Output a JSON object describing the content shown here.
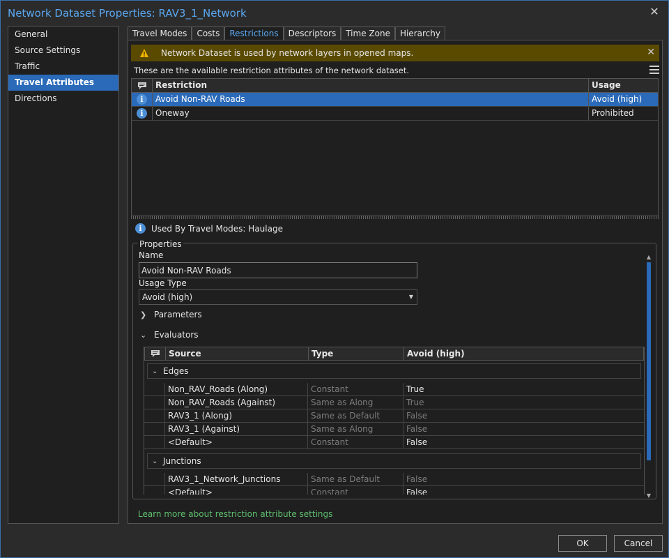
{
  "window": {
    "title": "Network Dataset Properties: RAV3_1_Network",
    "close_icon": "close-icon"
  },
  "nav": {
    "items": [
      {
        "label": "General",
        "active": false
      },
      {
        "label": "Source Settings",
        "active": false
      },
      {
        "label": "Traffic",
        "active": false
      },
      {
        "label": "Travel Attributes",
        "active": true
      },
      {
        "label": "Directions",
        "active": false
      }
    ]
  },
  "tabs": [
    {
      "label": "Travel Modes",
      "active": false
    },
    {
      "label": "Costs",
      "active": false
    },
    {
      "label": "Restrictions",
      "active": true
    },
    {
      "label": "Descriptors",
      "active": false
    },
    {
      "label": "Time Zone",
      "active": false
    },
    {
      "label": "Hierarchy",
      "active": false
    }
  ],
  "warning": {
    "text": "Network Dataset is used by network layers in opened maps.",
    "icon": "warning-icon"
  },
  "description": "These are the available restriction attributes of the network dataset.",
  "restrictions": {
    "columns": {
      "restriction": "Restriction",
      "usage": "Usage"
    },
    "rows": [
      {
        "name": "Avoid Non-RAV Roads",
        "usage": "Avoid (high)",
        "selected": true
      },
      {
        "name": "Oneway",
        "usage": "Prohibited",
        "selected": false
      }
    ]
  },
  "used_by": "Used By Travel Modes: Haulage",
  "properties": {
    "title": "Properties",
    "name_label": "Name",
    "name_value": "Avoid Non-RAV Roads",
    "usage_type_label": "Usage Type",
    "usage_type_value": "Avoid (high)",
    "parameters_label": "Parameters",
    "evaluators_label": "Evaluators"
  },
  "evaluators": {
    "columns": {
      "source": "Source",
      "type": "Type",
      "value": "Avoid (high)"
    },
    "groups": [
      {
        "label": "Edges",
        "rows": [
          {
            "source": "Non_RAV_Roads (Along)",
            "type": "Constant",
            "value": "True",
            "dim": false
          },
          {
            "source": "Non_RAV_Roads (Against)",
            "type": "Same as Along",
            "value": "True",
            "dim": true
          },
          {
            "source": "RAV3_1 (Along)",
            "type": "Same as Default",
            "value": "False",
            "dim": true
          },
          {
            "source": "RAV3_1 (Against)",
            "type": "Same as Along",
            "value": "False",
            "dim": true
          },
          {
            "source": "<Default>",
            "type": "Constant",
            "value": "False",
            "dim": false
          }
        ]
      },
      {
        "label": "Junctions",
        "rows": [
          {
            "source": "RAV3_1_Network_Junctions",
            "type": "Same as Default",
            "value": "False",
            "dim": true
          },
          {
            "source": "<Default>",
            "type": "Constant",
            "value": "False",
            "dim": false
          }
        ]
      }
    ]
  },
  "learn_more": "Learn more about restriction attribute settings",
  "buttons": {
    "ok": "OK",
    "cancel": "Cancel"
  },
  "colors": {
    "accent": "#2a6ab8",
    "title": "#5aa7f0",
    "warning_bg": "#5a4a00",
    "link": "#5fbf6f"
  }
}
